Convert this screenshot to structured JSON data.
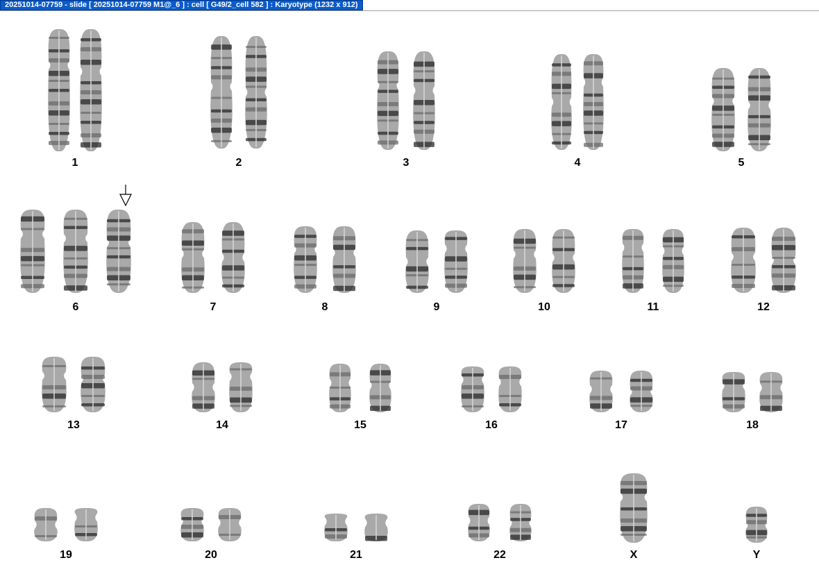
{
  "window": {
    "title": "20251014-07759 - slide [ 20251014-07759 M1@_6 ] : cell [ G49/2_cell 582 ] : Karyotype  (1232 x 912)"
  },
  "karyotype": {
    "colors": {
      "band_dark": "#2a2a2a",
      "band_mid": "#6b6b6b",
      "body": "#9a9a9a",
      "label": "#000000"
    },
    "groups": [
      {
        "label": "1",
        "count": 2
      },
      {
        "label": "2",
        "count": 2
      },
      {
        "label": "3",
        "count": 2
      },
      {
        "label": "4",
        "count": 2
      },
      {
        "label": "5",
        "count": 2
      },
      {
        "label": "6",
        "count": 3,
        "flagged": true
      },
      {
        "label": "7",
        "count": 2
      },
      {
        "label": "8",
        "count": 2
      },
      {
        "label": "9",
        "count": 2
      },
      {
        "label": "10",
        "count": 2
      },
      {
        "label": "11",
        "count": 2
      },
      {
        "label": "12",
        "count": 2
      },
      {
        "label": "13",
        "count": 2
      },
      {
        "label": "14",
        "count": 2
      },
      {
        "label": "15",
        "count": 2
      },
      {
        "label": "16",
        "count": 2
      },
      {
        "label": "17",
        "count": 2
      },
      {
        "label": "18",
        "count": 2
      },
      {
        "label": "19",
        "count": 2
      },
      {
        "label": "20",
        "count": 2
      },
      {
        "label": "21",
        "count": 2
      },
      {
        "label": "22",
        "count": 2
      },
      {
        "label": "X",
        "count": 1
      },
      {
        "label": "Y",
        "count": 1
      }
    ],
    "marker_icon": "down-arrow-icon"
  }
}
